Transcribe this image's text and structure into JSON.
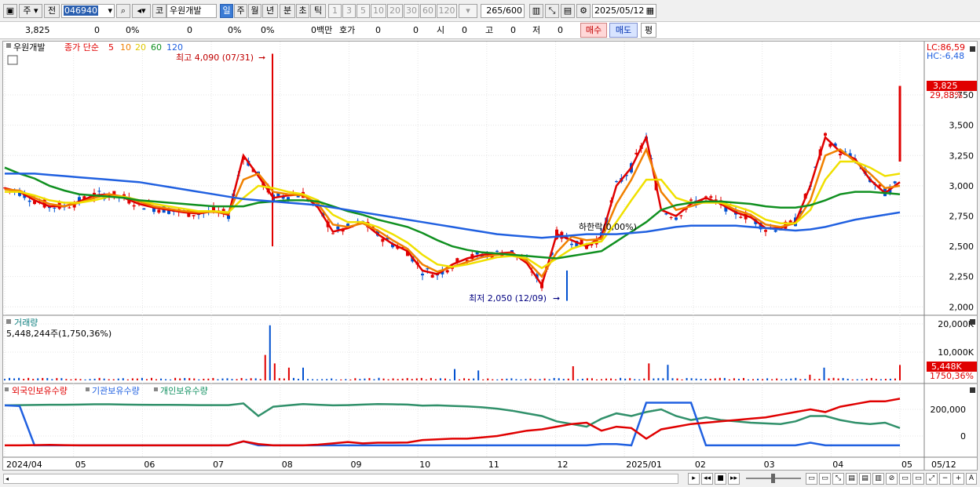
{
  "toolbar": {
    "market_type": "주",
    "prev_label": "전",
    "code": "046940",
    "market_badge": "코",
    "stock_name": "우원개발",
    "periods": [
      "일",
      "주",
      "월",
      "년",
      "분",
      "초",
      "틱"
    ],
    "active_period": "일",
    "intervals": [
      "1",
      "3",
      "5",
      "10",
      "20",
      "30",
      "60",
      "120"
    ],
    "view_count": "265",
    "view_total": "/600",
    "date": "2025/05/12"
  },
  "info": {
    "price": "3,825",
    "change": "0",
    "change_pct": "0%",
    "volume": "0",
    "vol_pct1": "0%",
    "vol_pct2": "0%",
    "amount": "0백만",
    "quote_label": "호가",
    "quote_v1": "0",
    "quote_v2": "0",
    "open_label": "시",
    "open_v": "0",
    "high_label": "고",
    "high_v": "0",
    "low_label": "저",
    "low_v": "0",
    "buy": "매수",
    "sell": "매도",
    "eval": "평"
  },
  "legend": {
    "name": "우원개발",
    "ma_label": "종가 단순",
    "ma5": "5",
    "ma10": "10",
    "ma20": "20",
    "ma60": "60",
    "ma120": "120",
    "lc": "LC:86,59",
    "hc": "HC:-6,48",
    "high_note": "최고 4,090 (07/31)",
    "low_note": "최저 2,050 (12/09)",
    "mid_note": "하한락(0,00%)",
    "current_price": "3,825",
    "current_pct": "29,88%"
  },
  "volume_panel": {
    "title": "거래량",
    "value": "5,448,244주(1,750,36%)",
    "current": "5,448K",
    "current_pct": "1750,36%"
  },
  "holding_panel": {
    "foreign": "외국인보유수량",
    "institution": "기관보유수량",
    "individual": "개인보유수량"
  },
  "colors": {
    "up": "#e00000",
    "down": "#0050d0",
    "ma5": "#e00000",
    "ma10": "#f08000",
    "ma20": "#f0e000",
    "ma60": "#109020",
    "ma120": "#2060e0"
  },
  "chart_data": {
    "type": "line",
    "title": "우원개발",
    "price_axis": {
      "ticks": [
        2000,
        2250,
        2500,
        2750,
        3000,
        3250,
        3500,
        3750
      ],
      "range": [
        1950,
        4100
      ]
    },
    "x_ticks": [
      "2024/04",
      "05",
      "06",
      "07",
      "08",
      "09",
      "10",
      "11",
      "12",
      "2025/01",
      "02",
      "03",
      "04",
      "05",
      "05/12"
    ],
    "series": [
      {
        "name": "5",
        "values": [
          2980,
          2950,
          2880,
          2830,
          2830,
          2870,
          2920,
          2930,
          2900,
          2850,
          2820,
          2800,
          2780,
          2770,
          2790,
          2760,
          3250,
          3080,
          2900,
          2920,
          2930,
          2820,
          2620,
          2650,
          2700,
          2600,
          2520,
          2460,
          2300,
          2270,
          2350,
          2400,
          2430,
          2440,
          2450,
          2360,
          2180,
          2600,
          2550,
          2500,
          2580,
          3000,
          3150,
          3400,
          2800,
          2750,
          2850,
          2900,
          2850,
          2780,
          2740,
          2650,
          2650,
          2700,
          3000,
          3400,
          3280,
          3220,
          3050,
          2940,
          3030
        ]
      },
      {
        "name": "10",
        "values": [
          2970,
          2960,
          2900,
          2850,
          2830,
          2860,
          2900,
          2930,
          2910,
          2870,
          2830,
          2810,
          2790,
          2780,
          2785,
          2770,
          3050,
          3100,
          2950,
          2930,
          2920,
          2850,
          2680,
          2660,
          2690,
          2630,
          2550,
          2480,
          2350,
          2290,
          2330,
          2370,
          2410,
          2430,
          2440,
          2380,
          2250,
          2450,
          2580,
          2550,
          2560,
          2850,
          3050,
          3300,
          2950,
          2800,
          2830,
          2870,
          2860,
          2800,
          2760,
          2680,
          2660,
          2690,
          2880,
          3250,
          3300,
          3200,
          3100,
          2980,
          3000
        ]
      },
      {
        "name": "20",
        "values": [
          2950,
          2950,
          2920,
          2880,
          2860,
          2860,
          2880,
          2910,
          2910,
          2880,
          2850,
          2830,
          2810,
          2790,
          2790,
          2780,
          2900,
          3000,
          2980,
          2950,
          2930,
          2880,
          2760,
          2700,
          2700,
          2660,
          2600,
          2530,
          2430,
          2350,
          2330,
          2350,
          2380,
          2410,
          2420,
          2400,
          2320,
          2400,
          2480,
          2520,
          2540,
          2700,
          2880,
          3050,
          3050,
          2900,
          2860,
          2860,
          2860,
          2830,
          2790,
          2720,
          2690,
          2690,
          2800,
          3050,
          3200,
          3200,
          3150,
          3080,
          3100
        ]
      },
      {
        "name": "60",
        "values": [
          3150,
          3100,
          3060,
          3000,
          2960,
          2930,
          2920,
          2910,
          2900,
          2880,
          2870,
          2860,
          2850,
          2840,
          2830,
          2830,
          2830,
          2860,
          2870,
          2880,
          2880,
          2870,
          2830,
          2790,
          2760,
          2720,
          2690,
          2660,
          2610,
          2550,
          2500,
          2470,
          2450,
          2440,
          2430,
          2420,
          2410,
          2400,
          2420,
          2440,
          2460,
          2540,
          2620,
          2700,
          2800,
          2840,
          2860,
          2870,
          2870,
          2860,
          2850,
          2830,
          2820,
          2820,
          2840,
          2880,
          2930,
          2950,
          2950,
          2940,
          2930
        ]
      },
      {
        "name": "120",
        "values": [
          3100,
          3100,
          3100,
          3090,
          3080,
          3070,
          3060,
          3050,
          3040,
          3030,
          3010,
          2990,
          2970,
          2950,
          2930,
          2910,
          2890,
          2880,
          2870,
          2860,
          2850,
          2840,
          2820,
          2800,
          2780,
          2760,
          2740,
          2720,
          2700,
          2680,
          2660,
          2640,
          2620,
          2600,
          2590,
          2580,
          2570,
          2580,
          2590,
          2600,
          2600,
          2600,
          2610,
          2620,
          2640,
          2660,
          2670,
          2670,
          2670,
          2670,
          2660,
          2650,
          2640,
          2630,
          2640,
          2660,
          2690,
          2720,
          2740,
          2760,
          2780
        ]
      }
    ]
  }
}
